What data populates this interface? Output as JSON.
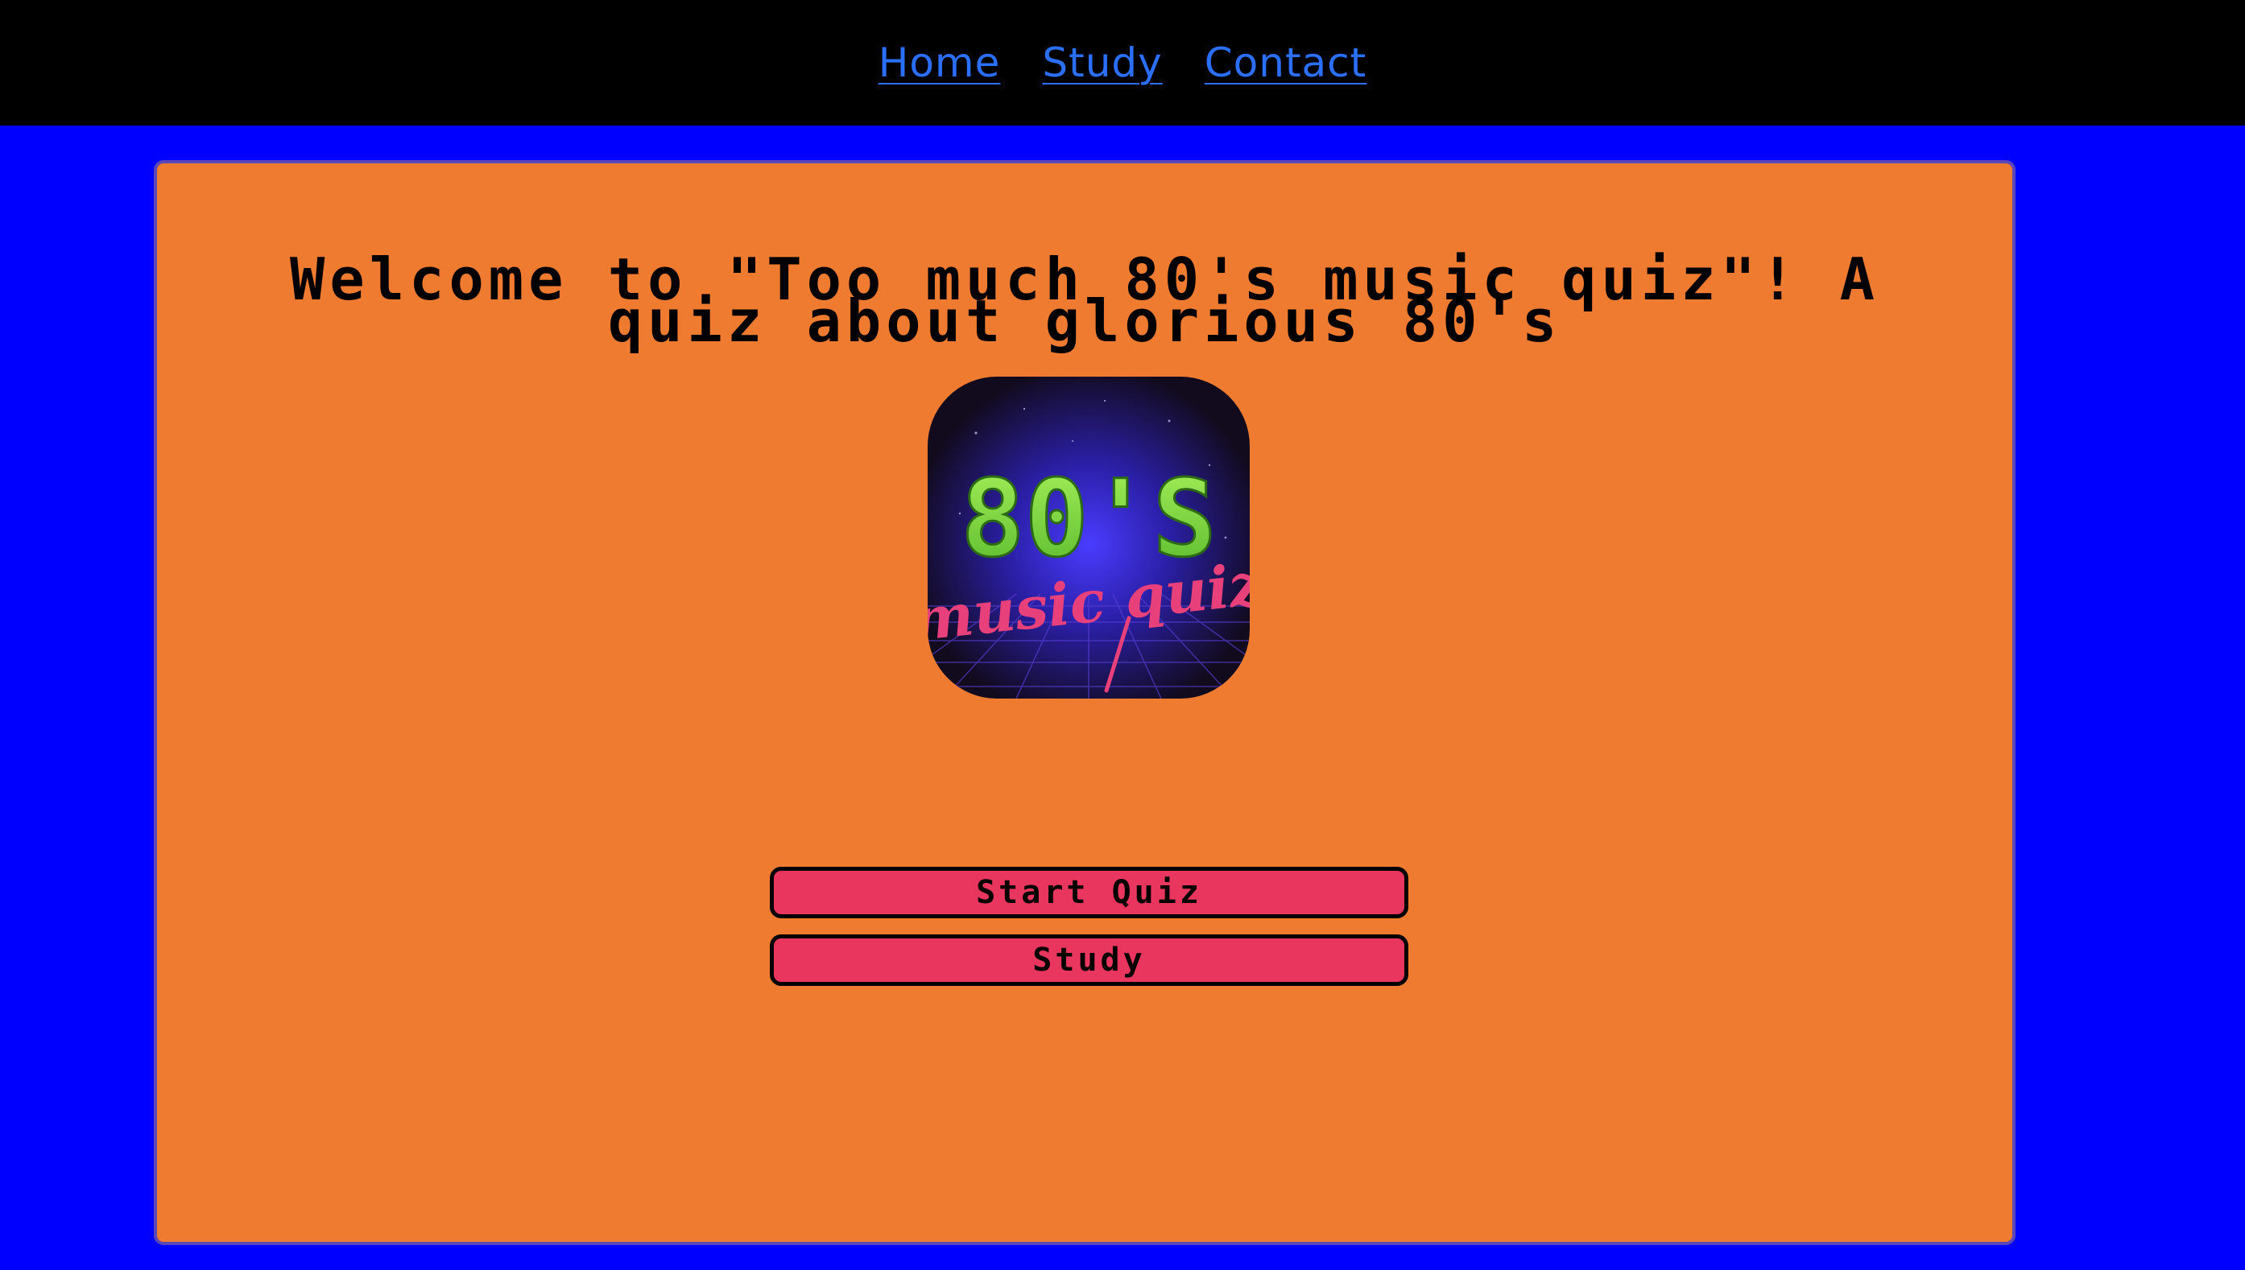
{
  "nav": {
    "links": [
      "Home",
      "Study",
      "Contact"
    ]
  },
  "main": {
    "title": "Welcome to \"Too much 80's music quiz\"! A quiz about glorious 80's",
    "logo": {
      "headline": "80'S",
      "script": "music quiz"
    },
    "buttons": {
      "start_label": "Start Quiz",
      "study_label": "Study"
    }
  },
  "colors": {
    "page_background": "#0000ff",
    "navbar_background": "#000000",
    "nav_link": "#2b6fff",
    "card_background": "#ef7b31",
    "card_border": "#5a47b8",
    "button_background": "#e8365f",
    "logo_headline": "#7ed63a",
    "logo_script": "#e8407a"
  }
}
